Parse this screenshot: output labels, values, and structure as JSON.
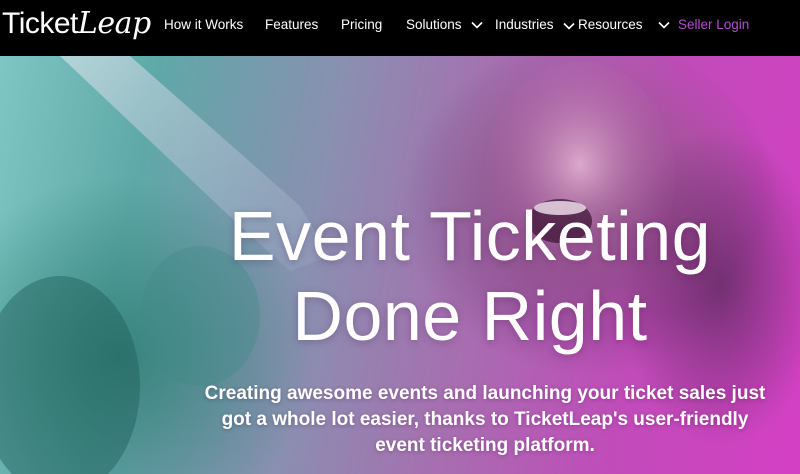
{
  "nav": {
    "logo_part1": "Ticket",
    "logo_part2": "Leap",
    "items": [
      {
        "label": "How it Works"
      },
      {
        "label": "Features"
      },
      {
        "label": "Pricing"
      },
      {
        "label": "Solutions"
      },
      {
        "label": "Industries"
      },
      {
        "label": "Resources"
      }
    ],
    "seller_login": "Seller Login"
  },
  "hero": {
    "headline_line1": "Event Ticketing",
    "headline_line2": "Done Right",
    "subtext": "Creating awesome events and launching your ticket sales just got a whole lot easier, thanks to TicketLeap's user-friendly event ticketing platform."
  },
  "colors": {
    "nav_bg": "#000000",
    "accent": "#b44cd1",
    "hero_left": "#7ec6c3",
    "hero_right": "#d43fc4"
  }
}
